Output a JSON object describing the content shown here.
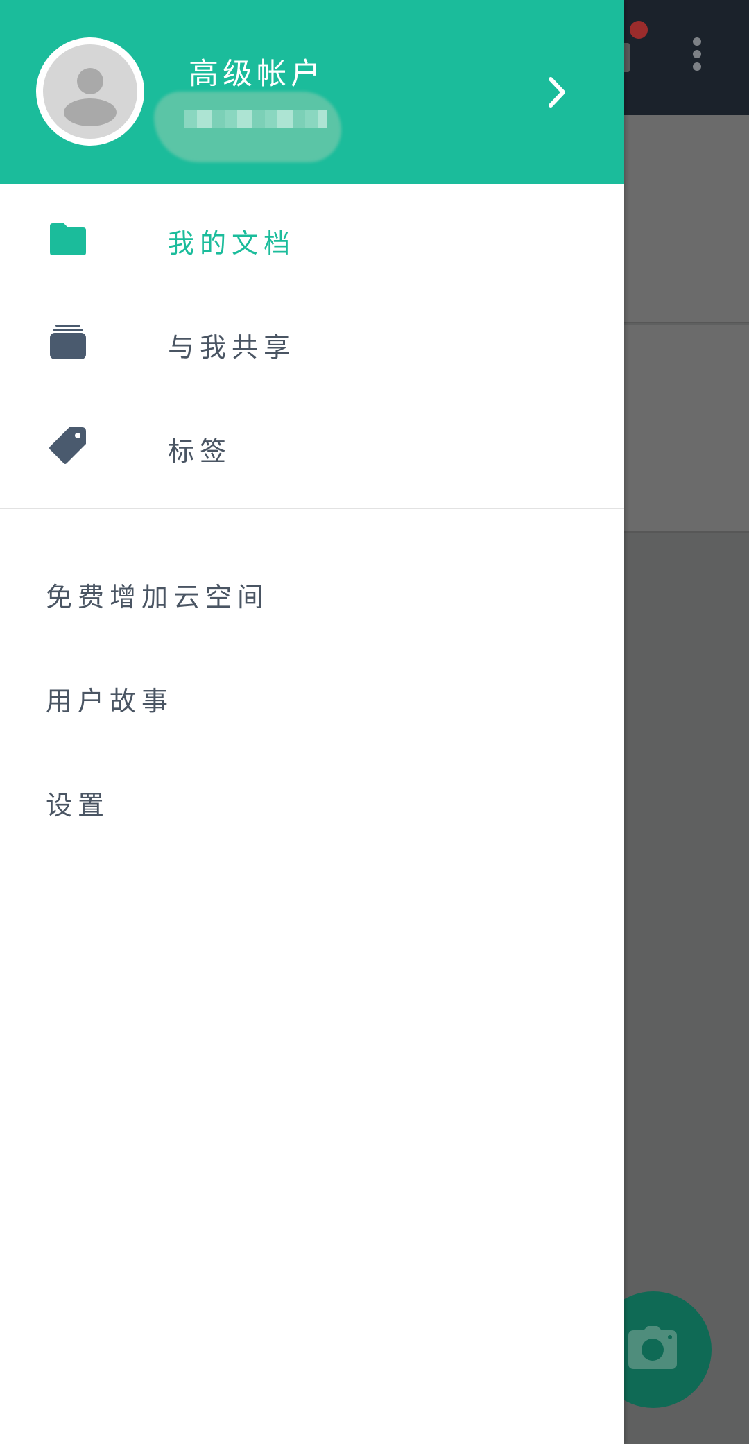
{
  "account": {
    "title": "高级帐户",
    "email_redacted": true
  },
  "menu": {
    "primary": [
      {
        "label": "我的文档",
        "icon": "folder-icon",
        "active": true
      },
      {
        "label": "与我共享",
        "icon": "shared-stack-icon",
        "active": false
      },
      {
        "label": "标签",
        "icon": "tag-icon",
        "active": false
      }
    ],
    "secondary": [
      {
        "label": "免费增加云空间"
      },
      {
        "label": "用户故事"
      },
      {
        "label": "设置"
      }
    ]
  },
  "colors": {
    "accent": "#1bbc9b",
    "icon": "#4a5a6e",
    "text": "#4a5563",
    "scrim_topbar": "#1b222b",
    "fab": "#0f6a55"
  },
  "background_app": {
    "fab_icon": "camera-icon",
    "menu_icon": "more-vert-icon"
  }
}
